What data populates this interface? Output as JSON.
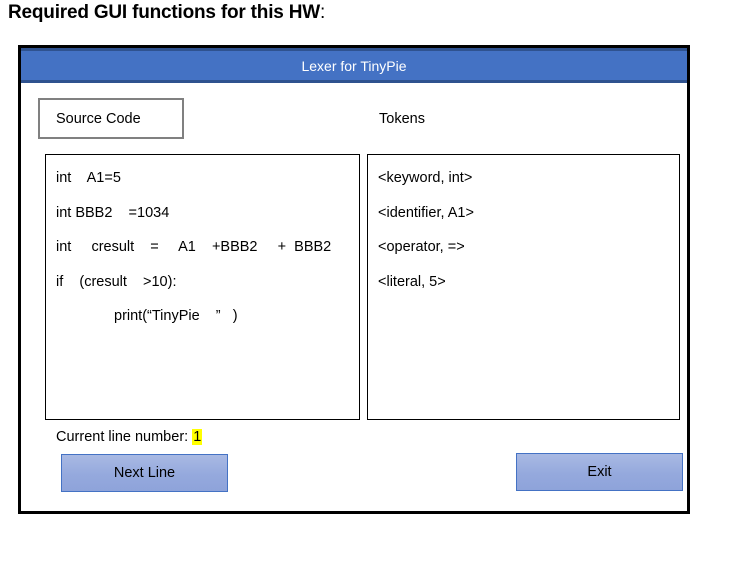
{
  "slide": {
    "heading": "Required GUI functions for this HW",
    "heading_suffix": ":"
  },
  "window": {
    "title": "Lexer for TinyPie",
    "colors": {
      "titlebar_bg": "#4472C4",
      "titlebar_border": "#2F528F",
      "titlebar_text": "#FFFFFF",
      "window_border": "#000000",
      "panel_border": "#000000",
      "label_box_border": "#808080",
      "button_border": "#4472C4",
      "button_fill_top": "#A9B9E3",
      "button_fill_bottom": "#8EA3DA",
      "highlight": "#FFFF00"
    }
  },
  "panels": {
    "source": {
      "label": "Source Code",
      "lines": [
        "int    A1=5",
        "int BBB2    =1034",
        "int     cresult    =     A1    +BBB2     +  BBB2",
        "if    (cresult    >10):",
        "print(“TinyPie    ”   )"
      ]
    },
    "tokens": {
      "label": "Tokens",
      "lines": [
        "<keyword, int>",
        "<identifier, A1>",
        "<operator, =>",
        "<literal, 5>"
      ]
    }
  },
  "status": {
    "current_line_label": "Current line number:",
    "current_line_value": "1"
  },
  "buttons": {
    "next_line": "Next Line",
    "exit": "Exit"
  }
}
